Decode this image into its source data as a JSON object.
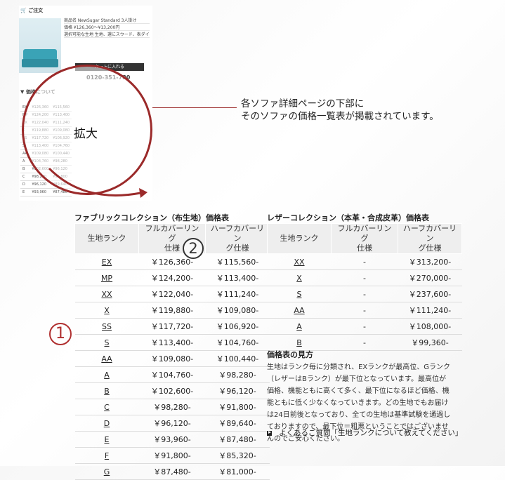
{
  "thumbnail": {
    "header": "ご注文",
    "product_rows": [
      "商品名   NewSugar Standard 3人掛け",
      "価格     ¥126,360〜¥13,200円",
      "選択可能な生地  生地、選にスウード、表ダイ、カバーの仕様 バンスカバー..."
    ],
    "cart_label": "カートに入れる",
    "tel": "0120-351-780",
    "section_title": "価格について",
    "zoom_label": "拡大"
  },
  "callout": {
    "line1": "各ソファ詳細ページの下部に",
    "line2": "そのソファの価格一覧表が掲載されています。"
  },
  "fabric": {
    "title": "ファブリックコレクション（布生地）価格表",
    "headers": [
      "生地ランク",
      "フルカバーリング\n仕様",
      "ハーフカバーリン\nグ仕様"
    ],
    "rows": [
      [
        "EX",
        "￥126,360-",
        "￥115,560-"
      ],
      [
        "MP",
        "￥124,200-",
        "￥113,400-"
      ],
      [
        "XX",
        "￥122,040-",
        "￥111,240-"
      ],
      [
        "X",
        "￥119,880-",
        "￥109,080-"
      ],
      [
        "SS",
        "￥117,720-",
        "￥106,920-"
      ],
      [
        "S",
        "￥113,400-",
        "￥104,760-"
      ],
      [
        "AA",
        "￥109,080-",
        "￥100,440-"
      ],
      [
        "A",
        "￥104,760-",
        "￥98,280-"
      ],
      [
        "B",
        "￥102,600-",
        "￥96,120-"
      ],
      [
        "C",
        "￥98,280-",
        "￥91,800-"
      ],
      [
        "D",
        "￥96,120-",
        "￥89,640-"
      ],
      [
        "E",
        "￥93,960-",
        "￥87,480-"
      ],
      [
        "F",
        "￥91,800-",
        "￥85,320-"
      ],
      [
        "G",
        "￥87,480-",
        "￥81,000-"
      ]
    ]
  },
  "leather": {
    "title": "レザーコレクション（本革・合成皮革）価格表",
    "headers": [
      "生地ランク",
      "フルカバーリング\n仕様",
      "ハーフカバーリン\nグ仕様"
    ],
    "rows": [
      [
        "XX",
        "-",
        "￥313,200-"
      ],
      [
        "X",
        "-",
        "￥270,000-"
      ],
      [
        "S",
        "-",
        "￥237,600-"
      ],
      [
        "AA",
        "-",
        "￥111,240-"
      ],
      [
        "A",
        "-",
        "￥108,000-"
      ],
      [
        "B",
        "-",
        "￥99,360-"
      ]
    ]
  },
  "guide": {
    "title": "価格表の見方",
    "body": "生地はランク毎に分類され、EXランクが最高位、Gランク（レザーはBランク）が最下位となっています。最高位が価格、機能ともに高くて多く、最下位になるほど価格、機能ともに低く少なくなっていきます。どの生地でもお届けは24日前後となっており、全ての生地は基準試験を通過しておりますので、最下位＝粗悪ということではございませんのでご安心ください。"
  },
  "faq_link": "よくあるご質問「生地ランクについて教えてください」",
  "markers": {
    "one": "1",
    "two": "2"
  }
}
